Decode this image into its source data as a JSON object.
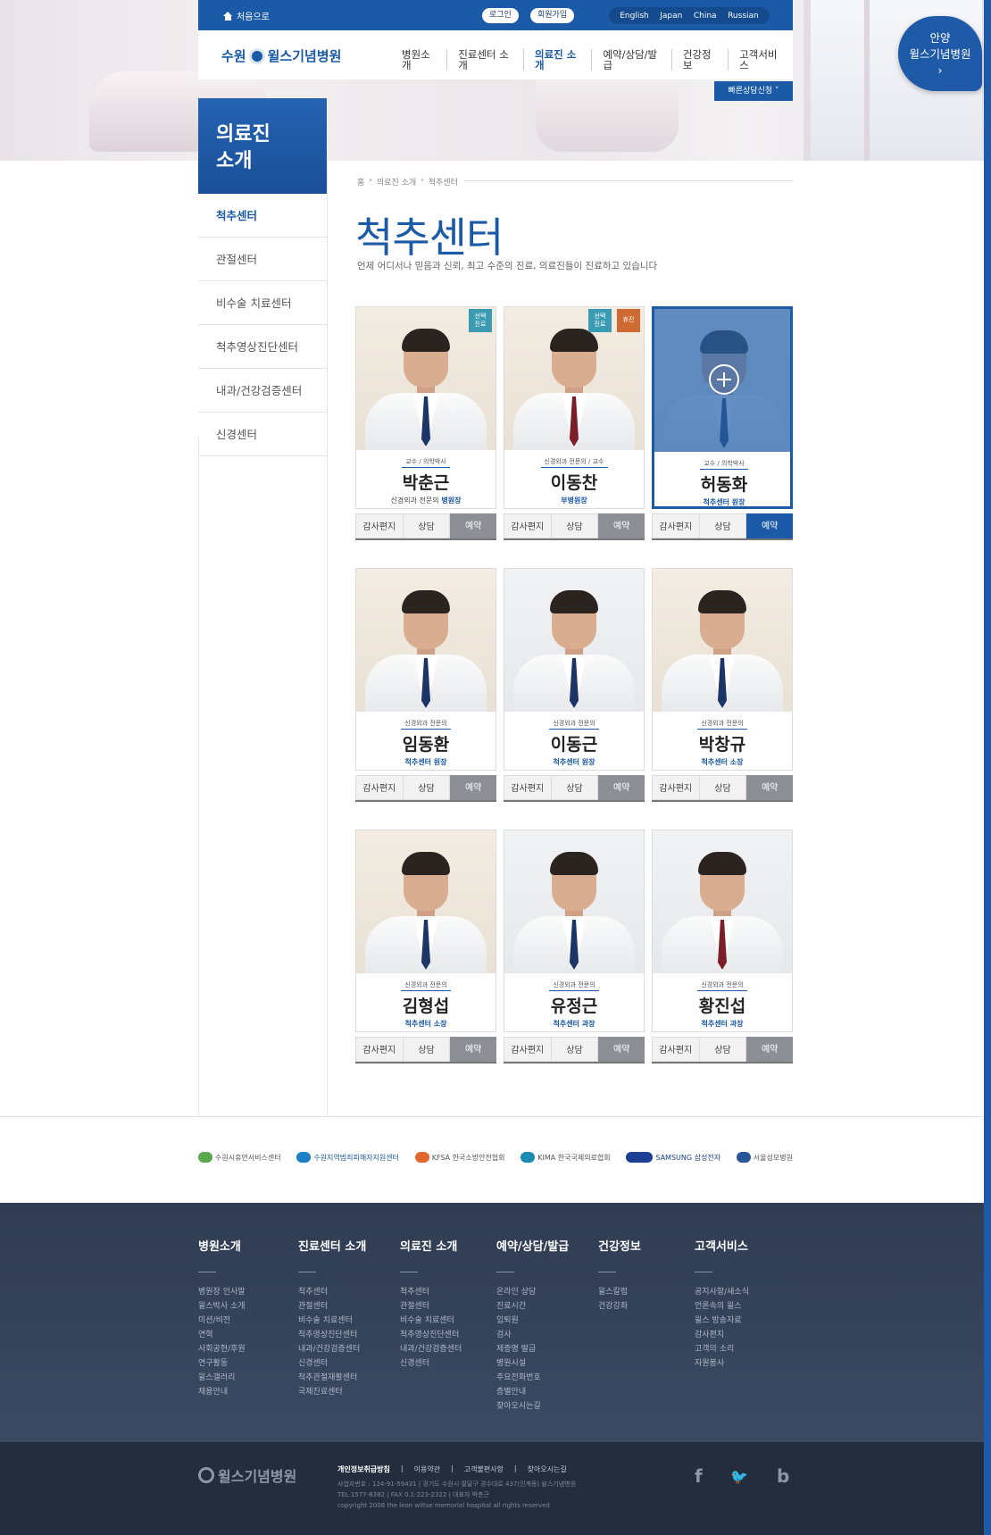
{
  "header": {
    "home_link": "처음으로",
    "login": "로그인",
    "signup": "회원가입",
    "languages": [
      "English",
      "Japan",
      "China",
      "Russian"
    ],
    "logo_text_left": "수원",
    "logo_text_right": "윌스기념병원",
    "nav": [
      "병원소개",
      "진료센터 소개",
      "의료진 소개",
      "예약/상담/발급",
      "건강정보",
      "고객서비스"
    ],
    "active_nav": "의료진 소개",
    "quick_consult": "빠른상담신청 ˅",
    "corner_badge_line1": "안양",
    "corner_badge_line2": "윌스기념병원",
    "corner_badge_arrow": "›"
  },
  "sidebar": {
    "title_line1": "의료진",
    "title_line2": "소개",
    "items": [
      "척추센터",
      "관절센터",
      "비수술 치료센터",
      "척추영상진단센터",
      "내과/건강검증센터",
      "신경센터"
    ]
  },
  "main": {
    "breadcrumb": [
      "홈",
      "›",
      "의료진 소개",
      "›",
      "척추센터"
    ],
    "title": "척추센터",
    "subtitle": "언제 어디서나 믿음과 신뢰, 최고 수준의 진료, 의료진들이 진료하고 있습니다"
  },
  "doctors": [
    {
      "role": "교수 / 의학박사",
      "name": "박춘근",
      "title_prefix": "신경외과 전문의",
      "title": "병원장",
      "badges": [
        "선택\n진료"
      ],
      "actions": [
        "감사편지",
        "상담",
        "예약"
      ]
    },
    {
      "role": "신경외과 전문의 / 교수",
      "name": "이동찬",
      "title_prefix": "",
      "title": "부병원장",
      "badges": [
        "선택\n진료",
        "휴진"
      ],
      "actions": [
        "감사편지",
        "상담",
        "예약"
      ]
    },
    {
      "role": "교수 / 의학박사",
      "name": "허동화",
      "title_prefix": "",
      "title": "척추센터 원장",
      "badges": [],
      "actions": [
        "감사편지",
        "상담",
        "예약"
      ]
    },
    {
      "role": "신경외과 전문의",
      "name": "임동환",
      "title_prefix": "",
      "title": "척추센터 원장",
      "badges": [],
      "actions": [
        "감사편지",
        "상담",
        "예약"
      ]
    },
    {
      "role": "신경외과 전문의",
      "name": "이동근",
      "title_prefix": "",
      "title": "척추센터 원장",
      "badges": [],
      "actions": [
        "감사편지",
        "상담",
        "예약"
      ]
    },
    {
      "role": "신경외과 전문의",
      "name": "박창규",
      "title_prefix": "",
      "title": "척추센터 소장",
      "badges": [],
      "actions": [
        "감사편지",
        "상담",
        "예약"
      ]
    },
    {
      "role": "신경외과 전문의",
      "name": "김형섭",
      "title_prefix": "",
      "title": "척추센터 소장",
      "badges": [],
      "actions": [
        "감사편지",
        "상담",
        "예약"
      ]
    },
    {
      "role": "신경외과 전문의",
      "name": "유정근",
      "title_prefix": "",
      "title": "척추센터 과장",
      "badges": [],
      "actions": [
        "감사편지",
        "상담",
        "예약"
      ]
    },
    {
      "role": "신경외과 전문의",
      "name": "황진섭",
      "title_prefix": "",
      "title": "척추센터 과장",
      "badges": [],
      "actions": [
        "감사편지",
        "상담",
        "예약"
      ]
    }
  ],
  "partners": [
    "수원시휴먼서비스센터",
    "수원지역범죄피해자지원센터",
    "KFSA 한국소방안전협회",
    "KIMA 한국국제의료협회",
    "SAMSUNG 삼성전자",
    "서울성모병원"
  ],
  "footer": {
    "columns": [
      {
        "title": "병원소개",
        "items": [
          "병원장 인사말",
          "윌스박사 소개",
          "미션/비전",
          "연혁",
          "사회공헌/후원",
          "연구활동",
          "윌스갤러리",
          "채용안내"
        ]
      },
      {
        "title": "진료센터 소개",
        "items": [
          "척추센터",
          "관절센터",
          "비수술 치료센터",
          "척추영상진단센터",
          "내과/건강검증센터",
          "신경센터",
          "척추관절재활센터",
          "국제진료센터"
        ]
      },
      {
        "title": "의료진 소개",
        "items": [
          "척추센터",
          "관절센터",
          "비수술 치료센터",
          "척추영상진단센터",
          "내과/건강검증센터",
          "신경센터"
        ]
      },
      {
        "title": "예약/상담/발급",
        "items": [
          "온라인 상담",
          "진료시간",
          "입퇴원",
          "검사",
          "제증명 발급",
          "병원시설",
          "주요전화번호",
          "층별안내",
          "찾아오시는길"
        ]
      },
      {
        "title": "건강정보",
        "items": [
          "윌스칼럼",
          "건강강좌"
        ]
      },
      {
        "title": "고객서비스",
        "items": [
          "공지사항/새소식",
          "언론속의 윌스",
          "윌스 방송자료",
          "감사편지",
          "고객의 소리",
          "자원봉사"
        ]
      }
    ],
    "logo": "윌스기념병원",
    "links": [
      "개인정보취급방침",
      "|",
      "이용약관",
      "|",
      "고객불편사항",
      "|",
      "찾아오시는길"
    ],
    "info_line1": "사업자번호 : 124-91-59431  |  경기도 수원시 팔달구 경수대로 437(인계동) 윌스기념병원",
    "info_line2": "TEL 1577-8382  |  FAX 0.1-223-2322  |  대표자 박춘근",
    "info_line3": "copyright 2008 the leon wiltse memorial hospital all rights reserved",
    "social": [
      "f",
      "🐦",
      "b"
    ]
  }
}
